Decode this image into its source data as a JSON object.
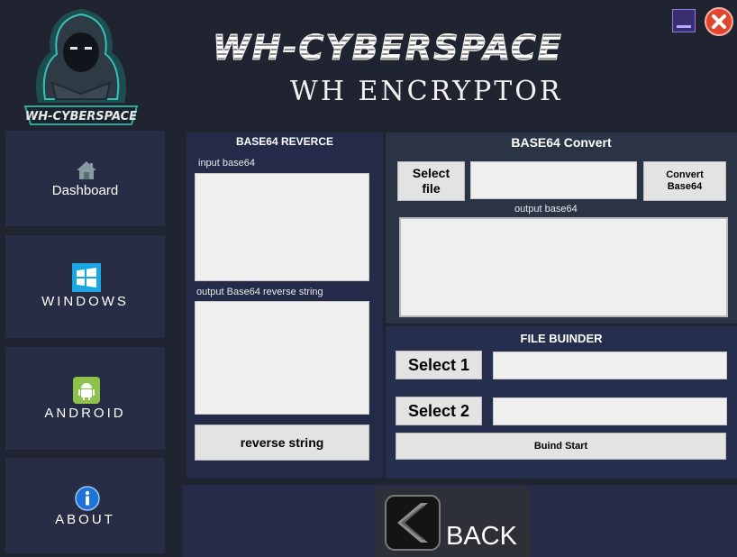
{
  "header": {
    "brand_title": "WH-CYBERSPACE",
    "app_title": "WH ENCRYPTOR",
    "logo_text": "WH-CYBERSPACE"
  },
  "window_controls": {
    "minimize_icon": "minimize-icon",
    "close_icon": "close-icon"
  },
  "sidebar": {
    "items": [
      {
        "label": "Dashboard",
        "icon": "home-icon"
      },
      {
        "label": "WINDOWS",
        "icon": "windows-icon"
      },
      {
        "label": "ANDROID",
        "icon": "android-icon"
      },
      {
        "label": "ABOUT",
        "icon": "info-icon"
      }
    ]
  },
  "reverse_panel": {
    "title": "BASE64 REVERCE",
    "input_label": "input base64",
    "input_value": "",
    "output_label": "output Base64 reverse string",
    "output_value": "",
    "button_label": "reverse string"
  },
  "convert_panel": {
    "title": "BASE64 Convert",
    "select_file_label": "Select file",
    "file_path_value": "",
    "convert_label": "Convert Base64",
    "output_label": "output base64",
    "output_value": ""
  },
  "binder_panel": {
    "title": "FILE BUINDER",
    "select1_label": "Select 1",
    "select1_value": "",
    "select2_label": "Select 2",
    "select2_value": "",
    "start_label": "Buind Start"
  },
  "footer": {
    "back_label": "BACK",
    "back_icon": "chevron-left-icon"
  },
  "colors": {
    "background": "#1f2430",
    "sidebar_item": "#262d44",
    "panel_reverse": "#242b48",
    "panel_convert": "#2b3445",
    "panel_binder": "#262e4e",
    "button": "#e3e3e3",
    "textbox": "#efefef",
    "close_red": "#e0452d",
    "minimize_purple": "#3b2f70"
  }
}
